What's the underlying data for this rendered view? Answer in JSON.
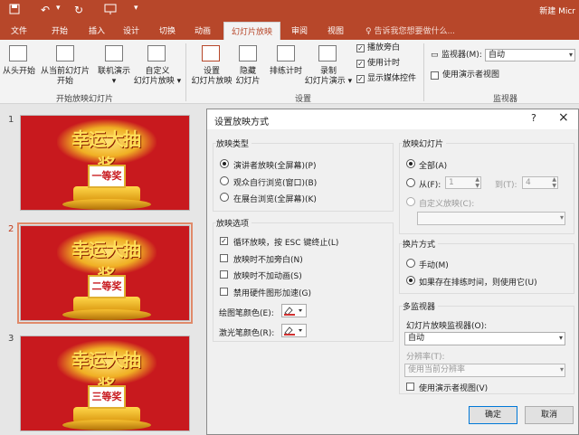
{
  "window": {
    "doc_title": "新建 Micr",
    "qa_icons": [
      "save-icon",
      "undo-icon",
      "redo-icon",
      "presentation-icon",
      "dropdown-icon"
    ]
  },
  "tabs": [
    "文件",
    "开始",
    "插入",
    "设计",
    "切换",
    "动画",
    "幻灯片放映",
    "审阅",
    "视图"
  ],
  "active_tab": "幻灯片放映",
  "tell_me": "告诉我您想要做什么...",
  "ribbon": {
    "btn_from_start": "从头开始",
    "btn_from_current_1": "从当前幻灯片",
    "btn_from_current_2": "开始",
    "btn_online_1": "联机演示",
    "btn_online_2": "▾",
    "btn_custom_1": "自定义",
    "btn_custom_2": "幻灯片放映 ▾",
    "group_start": "开始放映幻灯片",
    "btn_setup_1": "设置",
    "btn_setup_2": "幻灯片放映",
    "btn_hide_1": "隐藏",
    "btn_hide_2": "幻灯片",
    "btn_rehearse": "排练计时",
    "btn_record_1": "录制",
    "btn_record_2": "幻灯片演示 ▾",
    "chk_narration": "播放旁白",
    "chk_timings": "使用计时",
    "chk_media": "显示媒体控件",
    "group_setup": "设置",
    "monitor_label": "监视器(M):",
    "monitor_value": "自动",
    "presenter_view": "使用演示者视图",
    "group_monitors": "监视器"
  },
  "slides": [
    {
      "num": "1",
      "banner": "幸运大抽奖",
      "prize": "一等奖"
    },
    {
      "num": "2",
      "banner": "幸运大抽奖",
      "prize": "二等奖"
    },
    {
      "num": "3",
      "banner": "幸运大抽奖",
      "prize": "三等奖"
    }
  ],
  "dialog": {
    "title": "设置放映方式",
    "help": "?",
    "close": "×",
    "show_type": {
      "legend": "放映类型",
      "options": [
        "演讲者放映(全屏幕)(P)",
        "观众自行浏览(窗口)(B)",
        "在展台浏览(全屏幕)(K)"
      ],
      "selected": 0
    },
    "show_options": {
      "legend": "放映选项",
      "items": [
        {
          "label": "循环放映，按 ESC 键终止(L)",
          "checked": true
        },
        {
          "label": "放映时不加旁白(N)",
          "checked": false
        },
        {
          "label": "放映时不加动画(S)",
          "checked": false
        },
        {
          "label": "禁用硬件图形加速(G)",
          "checked": false
        }
      ],
      "pen_color": "绘图笔颜色(E):",
      "laser_color": "激光笔颜色(R):",
      "pen_hex": "#d03030",
      "laser_hex": "#d03030"
    },
    "show_slides": {
      "legend": "放映幻灯片",
      "all": "全部(A)",
      "from": "从(F):",
      "from_value": "1",
      "to": "到(T):",
      "to_value": "4",
      "custom": "自定义放映(C):"
    },
    "advance": {
      "legend": "换片方式",
      "manual": "手动(M)",
      "timings": "如果存在排练时间，则使用它(U)"
    },
    "monitors": {
      "legend": "多监视器",
      "monitor_label": "幻灯片放映监视器(O):",
      "monitor_value": "自动",
      "resolution_label": "分辨率(T):",
      "resolution_value": "使用当前分辨率",
      "presenter": "使用演示者视图(V)"
    },
    "ok": "确定",
    "cancel": "取消"
  }
}
